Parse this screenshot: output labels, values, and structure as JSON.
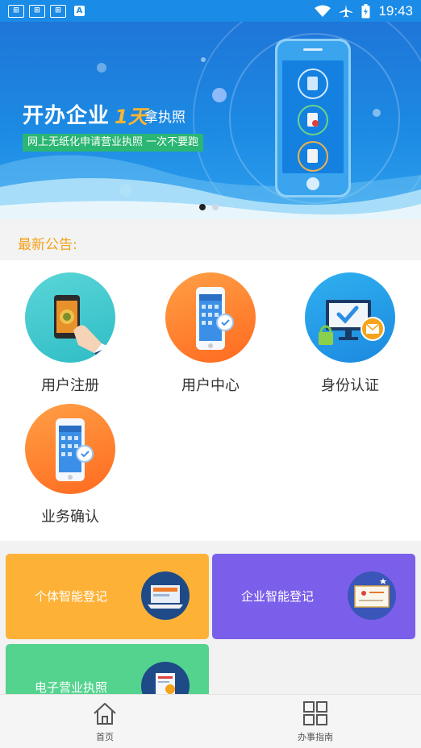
{
  "status_bar": {
    "time": "19:43",
    "notification_icons": [
      "game-icon",
      "game-icon",
      "game-icon",
      "a-icon"
    ]
  },
  "banner": {
    "title": "开办企业",
    "days": "1天",
    "take": "拿执照",
    "tagline": "网上无纸化申请营业执照  一次不要跑",
    "slides": 2,
    "active_slide": 0
  },
  "notice": {
    "label": "最新公告:"
  },
  "services": [
    {
      "label": "用户注册",
      "icon": "phone-tap-icon"
    },
    {
      "label": "用户中心",
      "icon": "phone-app-icon"
    },
    {
      "label": "身份认证",
      "icon": "monitor-lock-icon"
    },
    {
      "label": "业务确认",
      "icon": "phone-app-icon"
    }
  ],
  "cards": [
    {
      "label": "个体智能登记",
      "color": "#fdb237"
    },
    {
      "label": "企业智能登记",
      "color": "#7b5fea"
    },
    {
      "label": "电子营业执照",
      "color": "#53d38e"
    }
  ],
  "tabs": [
    {
      "label": "首页",
      "icon": "home-icon"
    },
    {
      "label": "办事指南",
      "icon": "grid-icon"
    }
  ],
  "colors": {
    "primary": "#1a8be6",
    "notice": "#f2a21b",
    "tag": "#2bb673"
  }
}
